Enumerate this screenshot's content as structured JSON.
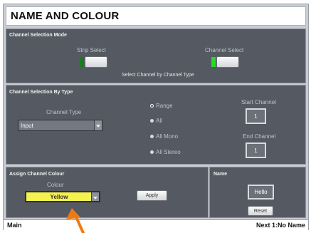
{
  "title": "NAME AND COLOUR",
  "mode": {
    "label": "Channel Selection Mode",
    "strip_select": "Strip Select",
    "channel_select": "Channel Select",
    "by_type_caption": "Select Channel by Channel Type",
    "strip_led_color": "#1f7a1f",
    "channel_led_color": "#22dd22"
  },
  "by_type": {
    "label": "Channel Selection By Type",
    "channel_type_label": "Channel Type",
    "channel_type_value": "Input",
    "options": [
      "Range",
      "All",
      "All Mono",
      "All Stereo"
    ],
    "start_label": "Start Channel",
    "start_value": "1",
    "end_label": "End Channel",
    "end_value": "1"
  },
  "assign": {
    "label": "Assign Channel Colour",
    "colour_label": "Colour",
    "colour_value": "Yellow",
    "colour_hex": "#f4f24e",
    "apply": "Apply"
  },
  "name": {
    "label": "Name",
    "value": "Hello",
    "reset": "Reset"
  },
  "status": {
    "left": "Main",
    "right": "Next 1:No Name"
  },
  "pointer_color": "#f07a12"
}
